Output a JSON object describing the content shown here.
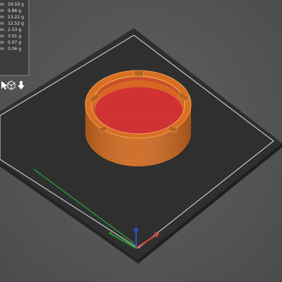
{
  "legend": {
    "unit_suffix": "m",
    "rows": [
      {
        "weight": "19.59 g"
      },
      {
        "weight": "9.86 g"
      },
      {
        "weight": "23.22 g"
      },
      {
        "weight": "12.52 g"
      },
      {
        "weight": "2.53 g"
      },
      {
        "weight": "3.01 g"
      },
      {
        "weight": "0.07 g"
      },
      {
        "weight": "0.06 g"
      }
    ]
  },
  "toolbar": {
    "icons": [
      "cursor-icon",
      "iso-view-cube-icon",
      "download-arrow-icon"
    ]
  },
  "colors": {
    "bed": "#2e2e2e",
    "bed_outline": "#e6e6e6",
    "model_outer": "#d86f22",
    "model_inner": "#d93535",
    "axis_x": "#d24a3a",
    "axis_y": "#27a035",
    "axis_z": "#2b4fd8"
  }
}
